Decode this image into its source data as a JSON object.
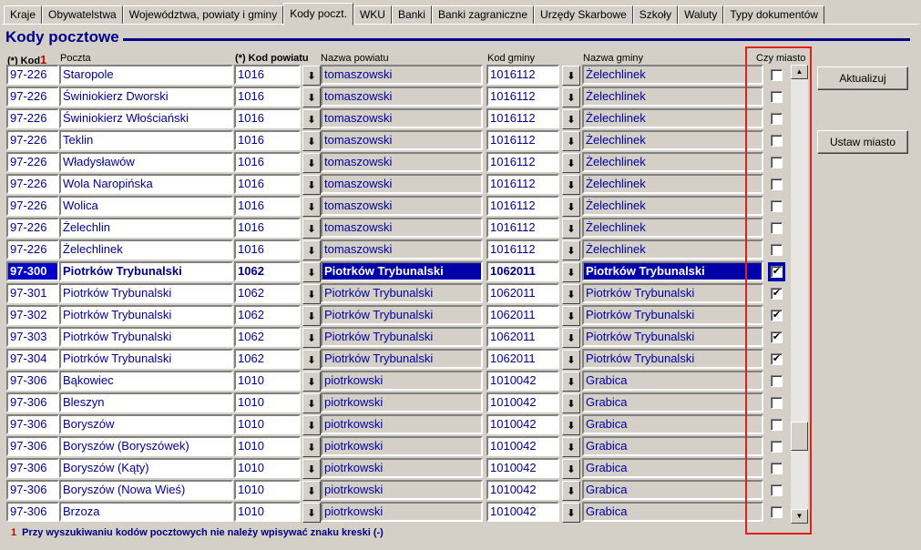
{
  "tabs": [
    "Kraje",
    "Obywatelstwa",
    "Województwa, powiaty i gminy",
    "Kody poczt.",
    "WKU",
    "Banki",
    "Banki zagraniczne",
    "Urzędy Skarbowe",
    "Szkoły",
    "Waluty",
    "Typy dokumentów"
  ],
  "active_tab": "Kody poczt.",
  "title": "Kody pocztowe",
  "headers": {
    "kod": "(*) Kod",
    "kod_mark": "1",
    "poczta": "Poczta",
    "kod_powiatu": "(*) Kod powiatu",
    "nazwa_powiatu": "Nazwa powiatu",
    "kod_gminy": "Kod gminy",
    "nazwa_gminy": "Nazwa gminy",
    "czy_miasto": "Czy miasto"
  },
  "rows": [
    {
      "kod": "97-226",
      "poczta": "Staropole",
      "kod_powiatu": "1016",
      "nazwa_powiatu": "tomaszowski",
      "kod_gminy": "1016112",
      "nazwa_gminy": "Żelechlinek",
      "miasto": false
    },
    {
      "kod": "97-226",
      "poczta": "Świniokierz Dworski",
      "kod_powiatu": "1016",
      "nazwa_powiatu": "tomaszowski",
      "kod_gminy": "1016112",
      "nazwa_gminy": "Żelechlinek",
      "miasto": false
    },
    {
      "kod": "97-226",
      "poczta": "Świniokierz Włościański",
      "kod_powiatu": "1016",
      "nazwa_powiatu": "tomaszowski",
      "kod_gminy": "1016112",
      "nazwa_gminy": "Żelechlinek",
      "miasto": false
    },
    {
      "kod": "97-226",
      "poczta": "Teklin",
      "kod_powiatu": "1016",
      "nazwa_powiatu": "tomaszowski",
      "kod_gminy": "1016112",
      "nazwa_gminy": "Żelechlinek",
      "miasto": false
    },
    {
      "kod": "97-226",
      "poczta": "Władysławów",
      "kod_powiatu": "1016",
      "nazwa_powiatu": "tomaszowski",
      "kod_gminy": "1016112",
      "nazwa_gminy": "Żelechlinek",
      "miasto": false
    },
    {
      "kod": "97-226",
      "poczta": "Wola Naropińska",
      "kod_powiatu": "1016",
      "nazwa_powiatu": "tomaszowski",
      "kod_gminy": "1016112",
      "nazwa_gminy": "Żelechlinek",
      "miasto": false
    },
    {
      "kod": "97-226",
      "poczta": "Wolica",
      "kod_powiatu": "1016",
      "nazwa_powiatu": "tomaszowski",
      "kod_gminy": "1016112",
      "nazwa_gminy": "Żelechlinek",
      "miasto": false
    },
    {
      "kod": "97-226",
      "poczta": "Żelechlin",
      "kod_powiatu": "1016",
      "nazwa_powiatu": "tomaszowski",
      "kod_gminy": "1016112",
      "nazwa_gminy": "Żelechlinek",
      "miasto": false
    },
    {
      "kod": "97-226",
      "poczta": "Żelechlinek",
      "kod_powiatu": "1016",
      "nazwa_powiatu": "tomaszowski",
      "kod_gminy": "1016112",
      "nazwa_gminy": "Żelechlinek",
      "miasto": false
    },
    {
      "kod": "97-300",
      "poczta": "Piotrków Trybunalski",
      "kod_powiatu": "1062",
      "nazwa_powiatu": "Piotrków Trybunalski",
      "kod_gminy": "1062011",
      "nazwa_gminy": "Piotrków Trybunalski",
      "miasto": true,
      "selected": true
    },
    {
      "kod": "97-301",
      "poczta": "Piotrków Trybunalski",
      "kod_powiatu": "1062",
      "nazwa_powiatu": "Piotrków Trybunalski",
      "kod_gminy": "1062011",
      "nazwa_gminy": "Piotrków Trybunalski",
      "miasto": true
    },
    {
      "kod": "97-302",
      "poczta": "Piotrków Trybunalski",
      "kod_powiatu": "1062",
      "nazwa_powiatu": "Piotrków Trybunalski",
      "kod_gminy": "1062011",
      "nazwa_gminy": "Piotrków Trybunalski",
      "miasto": true
    },
    {
      "kod": "97-303",
      "poczta": "Piotrków Trybunalski",
      "kod_powiatu": "1062",
      "nazwa_powiatu": "Piotrków Trybunalski",
      "kod_gminy": "1062011",
      "nazwa_gminy": "Piotrków Trybunalski",
      "miasto": true
    },
    {
      "kod": "97-304",
      "poczta": "Piotrków Trybunalski",
      "kod_powiatu": "1062",
      "nazwa_powiatu": "Piotrków Trybunalski",
      "kod_gminy": "1062011",
      "nazwa_gminy": "Piotrków Trybunalski",
      "miasto": true
    },
    {
      "kod": "97-306",
      "poczta": "Bąkowiec",
      "kod_powiatu": "1010",
      "nazwa_powiatu": "piotrkowski",
      "kod_gminy": "1010042",
      "nazwa_gminy": "Grabica",
      "miasto": false
    },
    {
      "kod": "97-306",
      "poczta": "Bleszyn",
      "kod_powiatu": "1010",
      "nazwa_powiatu": "piotrkowski",
      "kod_gminy": "1010042",
      "nazwa_gminy": "Grabica",
      "miasto": false
    },
    {
      "kod": "97-306",
      "poczta": "Boryszów",
      "kod_powiatu": "1010",
      "nazwa_powiatu": "piotrkowski",
      "kod_gminy": "1010042",
      "nazwa_gminy": "Grabica",
      "miasto": false
    },
    {
      "kod": "97-306",
      "poczta": "Boryszów (Boryszówek)",
      "kod_powiatu": "1010",
      "nazwa_powiatu": "piotrkowski",
      "kod_gminy": "1010042",
      "nazwa_gminy": "Grabica",
      "miasto": false
    },
    {
      "kod": "97-306",
      "poczta": "Boryszów (Kąty)",
      "kod_powiatu": "1010",
      "nazwa_powiatu": "piotrkowski",
      "kod_gminy": "1010042",
      "nazwa_gminy": "Grabica",
      "miasto": false
    },
    {
      "kod": "97-306",
      "poczta": "Boryszów (Nowa Wieś)",
      "kod_powiatu": "1010",
      "nazwa_powiatu": "piotrkowski",
      "kod_gminy": "1010042",
      "nazwa_gminy": "Grabica",
      "miasto": false
    },
    {
      "kod": "97-306",
      "poczta": "Brzoza",
      "kod_powiatu": "1010",
      "nazwa_powiatu": "piotrkowski",
      "kod_gminy": "1010042",
      "nazwa_gminy": "Grabica",
      "miasto": false
    }
  ],
  "buttons": {
    "aktualizuj": "Aktualizuj",
    "ustaw_miasto": "Ustaw miasto"
  },
  "footer": {
    "num": "1",
    "text": "Przy wyszukiwaniu kodów pocztowych nie należy wpisywać znaku kreski (-)"
  },
  "icons": {
    "lookup": "down-arrow-lookup-icon",
    "scroll_up": "scroll-up-arrow-icon",
    "scroll_down": "scroll-down-arrow-icon"
  },
  "colors": {
    "accent": "#00008b",
    "selection": "#0000a8",
    "highlight_frame": "#e0201a",
    "face": "#d4d0c8"
  }
}
